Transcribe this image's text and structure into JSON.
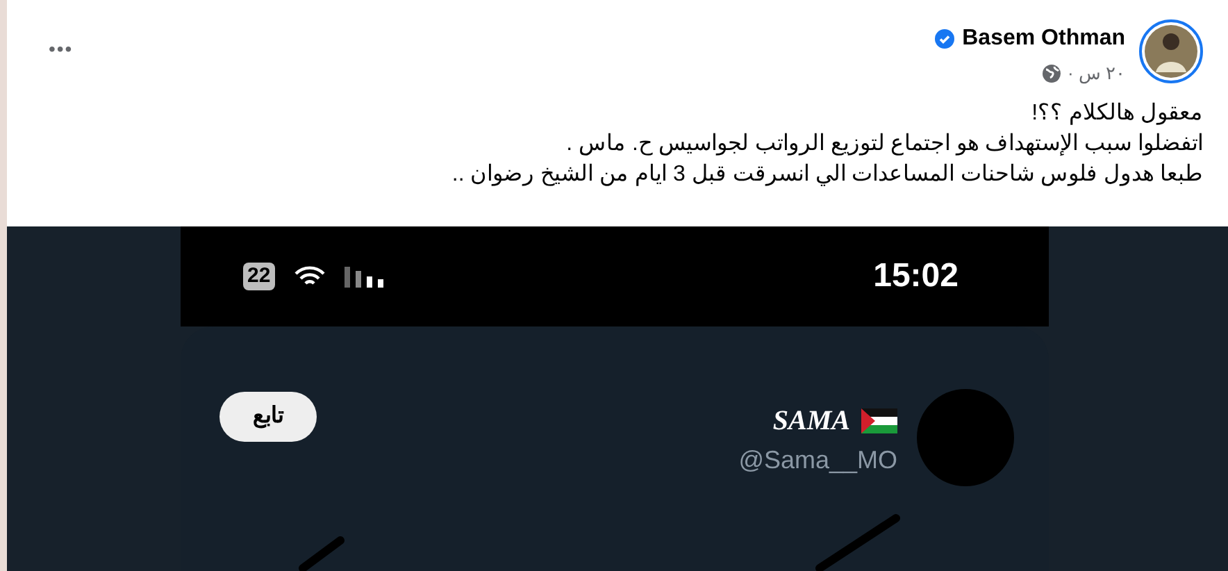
{
  "post": {
    "author": "Basem Othman",
    "verified": true,
    "time": "٢٠ س ·",
    "menu": "•••",
    "lines": [
      "معقول هالكلام ؟؟!",
      "اتفضلوا سبب الإستهداف هو اجتماع لتوزيع الرواتب لجواسيس ح. ماس .",
      "طبعا هدول فلوس شاحنات المساعدات الي انسرقت قبل 3 ايام من الشيخ رضوان .."
    ]
  },
  "screenshot": {
    "status_bar": {
      "battery": "22",
      "time": "15:02"
    },
    "tweet": {
      "name": "SAMA",
      "handle": "@Sama__MO",
      "follow_button": "تابع"
    }
  }
}
